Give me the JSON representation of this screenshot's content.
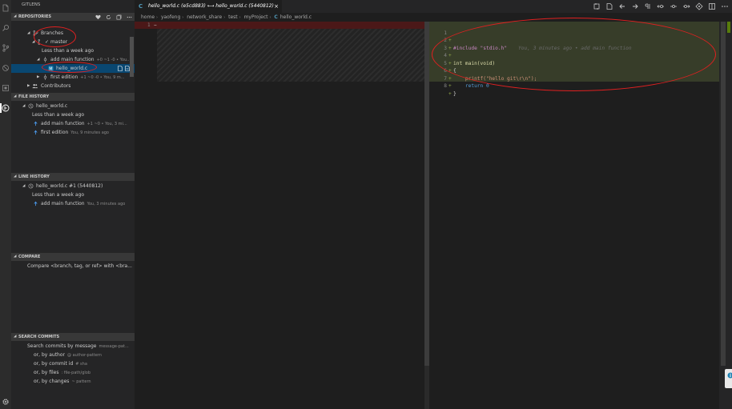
{
  "sidebar": {
    "title": "GITLENS",
    "repositories": {
      "header": "REPOSITORIES",
      "branches_label": "Branches",
      "branch_name": "master",
      "branch_check": "✓",
      "date_group": "Less than a week ago",
      "commit1_label": "add main function",
      "commit1_desc": "+0 ~1 -0 • You...",
      "file_label": "hello_world.c",
      "commit2_label": "first edition",
      "commit2_desc": "+1 ~0 -0 • You, 9 m...",
      "contributors_label": "Contributors"
    },
    "file_history": {
      "header": "FILE HISTORY",
      "file_label": "hello_world.c",
      "date_group": "Less than a week ago",
      "commit1_label": "add main function",
      "commit1_desc": "+1 ~0 • You, 3 mi...",
      "commit2_label": "first edition",
      "commit2_desc": "You, 9 minutes ago"
    },
    "line_history": {
      "header": "LINE HISTORY",
      "file_label": "hello_world.c #1 (5440812)",
      "date_group": "Less than a week ago",
      "commit_label": "add main function",
      "commit_desc": "You, 3 minutes ago"
    },
    "compare": {
      "header": "COMPARE",
      "item_label": "Compare <branch, tag, or ref> with <bra..."
    },
    "search_commits": {
      "header": "SEARCH COMMITS",
      "items": [
        {
          "label": "Search commits by message",
          "desc": "message-pat..."
        },
        {
          "label": "or, by author",
          "desc": "@ author-pattern"
        },
        {
          "label": "or, by commit id",
          "desc": "# sha"
        },
        {
          "label": "or, by files",
          "desc": ": file-path/glob"
        },
        {
          "label": "or, by changes",
          "desc": "~ pattern"
        }
      ]
    }
  },
  "tab": {
    "icon_letter": "C",
    "title": "hello_world.c (e5cd883) ⟷ hello_world.c (5440812)",
    "close": "×"
  },
  "breadcrumb": {
    "parts": [
      "home",
      "yaofeng",
      "network_share",
      "test",
      "myProject"
    ],
    "file_icon": "C",
    "file": "hello_world.c"
  },
  "left_editor": {
    "line1": "1",
    "marker": "−"
  },
  "right_editor": {
    "lines": [
      {
        "num": "1",
        "code": "#include \"stdio.h\""
      },
      {
        "num": "2",
        "code": ""
      },
      {
        "num": "3",
        "code": "int main(void)"
      },
      {
        "num": "4",
        "code": "{"
      },
      {
        "num": "5",
        "code": "    printf(\"hello git\\r\\n\");"
      },
      {
        "num": "6",
        "code": "    return 0"
      },
      {
        "num": "7",
        "code": "}"
      },
      {
        "num": "8",
        "code": ""
      }
    ],
    "blame": "You, 3 minutes ago • add main function"
  }
}
